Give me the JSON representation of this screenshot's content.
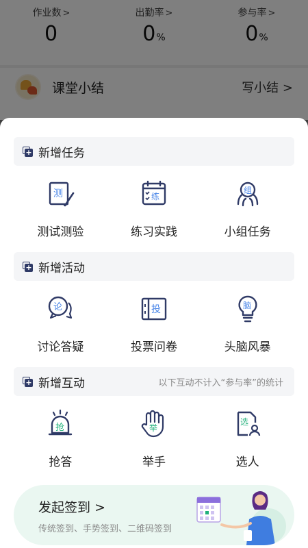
{
  "stats": [
    {
      "label": "作业数",
      "value": "0",
      "unit": ""
    },
    {
      "label": "出勤率",
      "value": "0",
      "unit": "%"
    },
    {
      "label": "参与率",
      "value": "0",
      "unit": "%"
    }
  ],
  "summary": {
    "title": "课堂小结",
    "link": "写小结"
  },
  "sections": {
    "tasks": {
      "title": "新增任务",
      "items": [
        {
          "label": "测试测验",
          "glyph": "测",
          "icon": "test-icon"
        },
        {
          "label": "练习实践",
          "glyph": "练",
          "icon": "practice-calendar-icon"
        },
        {
          "label": "小组任务",
          "glyph": "组",
          "icon": "group-icon"
        }
      ]
    },
    "activities": {
      "title": "新增活动",
      "items": [
        {
          "label": "讨论答疑",
          "glyph": "论",
          "icon": "discussion-icon"
        },
        {
          "label": "投票问卷",
          "glyph": "投",
          "icon": "vote-icon"
        },
        {
          "label": "头脑风暴",
          "glyph": "脑",
          "icon": "brainstorm-bulb-icon"
        }
      ]
    },
    "interactions": {
      "title": "新增互动",
      "note": "以下互动不计入“参与率”的统计",
      "items": [
        {
          "label": "抢答",
          "glyph": "抢",
          "icon": "quick-answer-bell-icon"
        },
        {
          "label": "举手",
          "glyph": "举",
          "icon": "raise-hand-icon"
        },
        {
          "label": "选人",
          "glyph": "选",
          "icon": "pick-person-icon"
        }
      ]
    }
  },
  "signin": {
    "title": "发起签到",
    "subtitle": "传统签到、手势签到、二维码签到"
  },
  "colors": {
    "icon_dark": "#2f3a66",
    "icon_accent": "#4a86e8",
    "banner_bg": "#eaf7f1",
    "sheet_bg": "#ffffff"
  }
}
